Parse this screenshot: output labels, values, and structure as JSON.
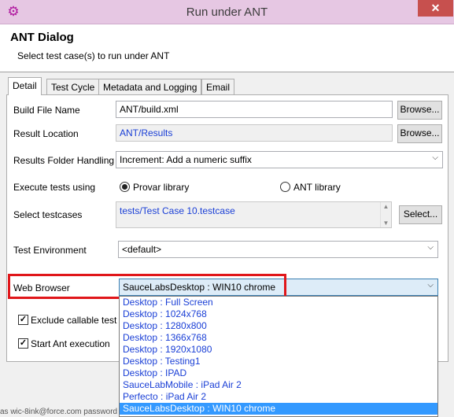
{
  "window": {
    "title": "Run under ANT",
    "app_icon": "gear-icon",
    "close": "✕"
  },
  "dialog": {
    "title": "ANT Dialog",
    "subtitle": "Select test case(s) to run under ANT"
  },
  "tabs": [
    "Detail",
    "Test Cycle",
    "Metadata and Logging",
    "Email"
  ],
  "form": {
    "build_file": {
      "label": "Build File Name",
      "value": "ANT/build.xml",
      "button": "Browse..."
    },
    "result_location": {
      "label": "Result Location",
      "value": "ANT/Results",
      "button": "Browse..."
    },
    "results_folder": {
      "label": "Results Folder Handling",
      "value": "Increment: Add a numeric suffix"
    },
    "execute_using": {
      "label": "Execute tests using",
      "option1": "Provar library",
      "option2": "ANT library",
      "selected": "Provar library"
    },
    "select_testcases": {
      "label": "Select testcases",
      "value": "tests/Test Case 10.testcase",
      "button": "Select..."
    },
    "test_environment": {
      "label": "Test Environment",
      "value": "<default>"
    },
    "web_browser": {
      "label": "Web Browser",
      "value": "SauceLabsDesktop : WIN10 chrome"
    },
    "exclude_callable": {
      "label": "Exclude callable test c",
      "checked": true
    },
    "start_ant": {
      "label": "Start Ant execution",
      "checked": true
    }
  },
  "browser_options": [
    "Desktop : Full Screen",
    "Desktop : 1024x768",
    "Desktop : 1280x800",
    "Desktop : 1366x768",
    "Desktop : 1920x1080",
    "Desktop : Testing1",
    "Desktop : IPAD",
    "SauceLabMobile : iPad Air 2",
    "Perfecto : iPad Air 2",
    "SauceLabsDesktop : WIN10 chrome"
  ],
  "selected_browser_index": 9,
  "bottom_fragment": "as wic-8ink@force.com password"
}
